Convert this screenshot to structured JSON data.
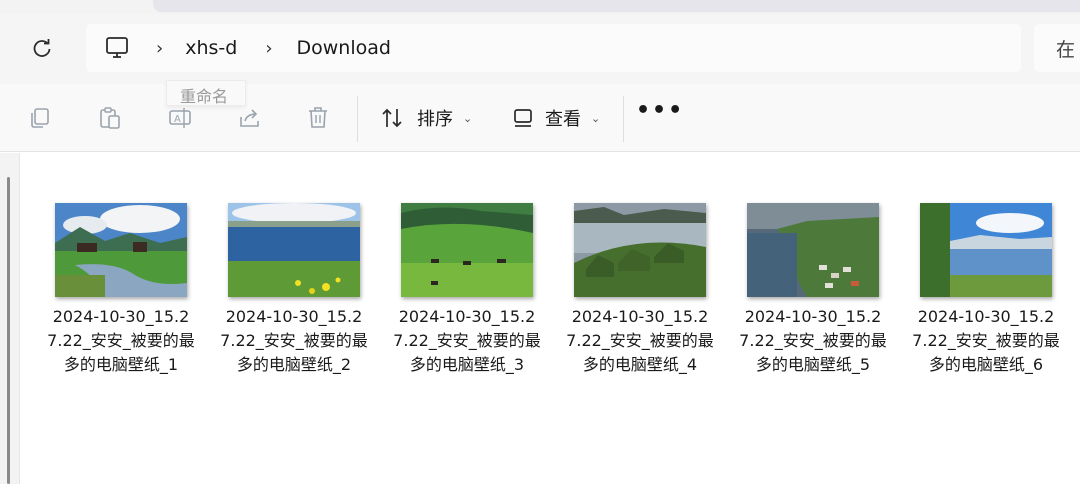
{
  "window": {
    "search_hint": "在"
  },
  "address_bar": {
    "refresh_icon": "refresh-icon",
    "root_icon": "this-pc-icon",
    "breadcrumbs": [
      "xhs-d",
      "Download"
    ]
  },
  "toolbar": {
    "copy_icon": "copy-icon",
    "paste_icon": "paste-icon",
    "rename_icon": "rename-icon",
    "share_icon": "share-icon",
    "delete_icon": "delete-icon",
    "rename_tooltip": "重命名",
    "sort_label": "排序",
    "view_label": "查看",
    "more_label": "•••"
  },
  "files": [
    {
      "name": "2024-10-30_15.27.22_安安_被要的最多的电脑壁纸_1",
      "thumbnail": "meadow-stream-cabins"
    },
    {
      "name": "2024-10-30_15.27.22_安安_被要的最多的电脑壁纸_2",
      "thumbnail": "lake-flowers-shore"
    },
    {
      "name": "2024-10-30_15.27.22_安安_被要的最多的电脑壁纸_3",
      "thumbnail": "green-hills-cattle"
    },
    {
      "name": "2024-10-30_15.27.22_安安_被要的最多的电脑壁纸_4",
      "thumbnail": "turf-roof-houses"
    },
    {
      "name": "2024-10-30_15.27.22_安安_被要的最多的电脑壁纸_5",
      "thumbnail": "coastal-village"
    },
    {
      "name": "2024-10-30_15.27.22_安安_被要的最多的电脑壁纸_6",
      "thumbnail": "mountain-lake-tree"
    }
  ],
  "colors": {
    "toolbar_bg": "#f9f9f9",
    "address_bg": "#f5f5f5",
    "disabled_icon": "#9aa3ad",
    "text": "#1a1a1a"
  }
}
